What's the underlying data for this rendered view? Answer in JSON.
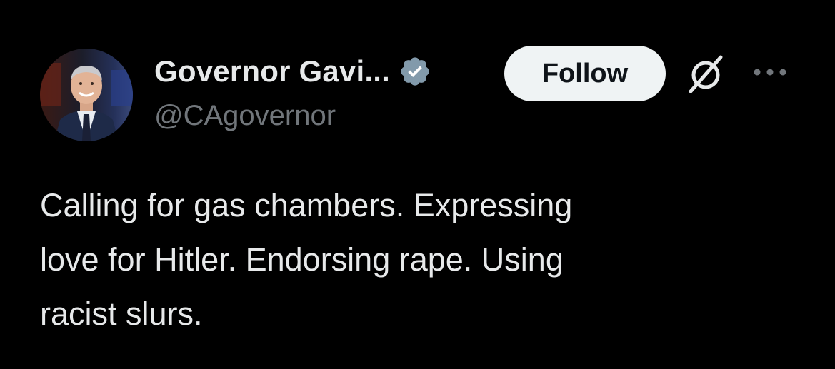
{
  "author": {
    "display_name": "Governor Gavi...",
    "handle": "@CAgovernor",
    "verified_badge": "verified-badge-icon",
    "verified_color": "#829aab"
  },
  "actions": {
    "follow_label": "Follow",
    "grok_icon": "slashed-circle-icon",
    "more_icon": "ellipsis-icon"
  },
  "tweet": {
    "lines": [
      "Calling for gas chambers. Expressing",
      "love for Hitler. Endorsing rape. Using",
      "racist slurs."
    ]
  },
  "colors": {
    "background": "#000000",
    "text_primary": "#e7e9ea",
    "text_secondary": "#71767b",
    "button_bg": "#eff3f4",
    "button_text": "#0f1419"
  }
}
